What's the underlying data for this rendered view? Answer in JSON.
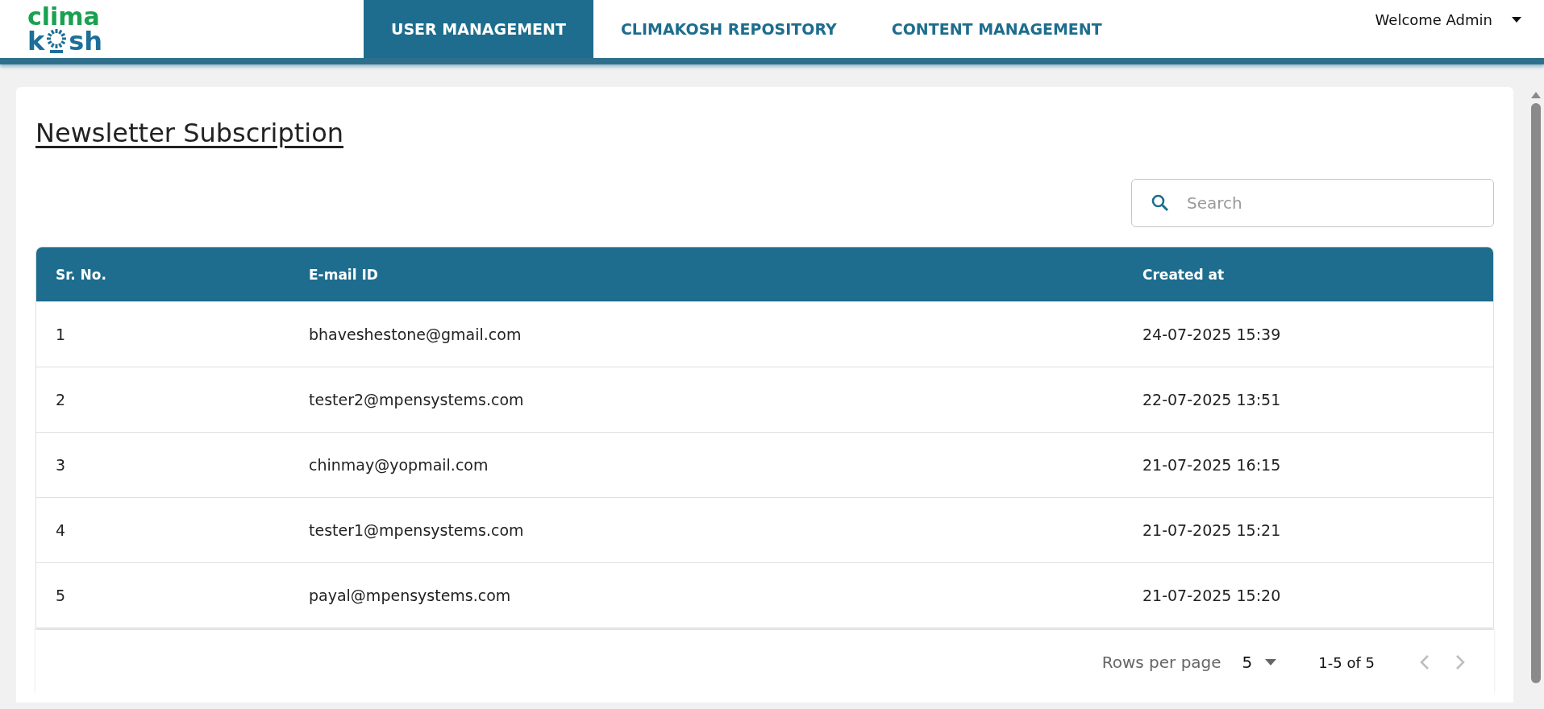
{
  "logo": {
    "top": "clima",
    "bottom_left": "k",
    "bottom_right": "sh"
  },
  "nav": [
    {
      "label": "USER MANAGEMENT",
      "selected": true
    },
    {
      "label": "CLIMAKOSH REPOSITORY",
      "selected": false
    },
    {
      "label": "CONTENT MANAGEMENT",
      "selected": false
    }
  ],
  "user_menu": {
    "label": "Welcome Admin"
  },
  "page_title": "Newsletter Subscription",
  "search": {
    "placeholder": "Search"
  },
  "table": {
    "columns": [
      "Sr. No.",
      "E-mail ID",
      "Created at"
    ],
    "rows": [
      [
        "1",
        "bhaveshestone@gmail.com",
        "24-07-2025 15:39"
      ],
      [
        "2",
        "tester2@mpensystems.com",
        "22-07-2025 13:51"
      ],
      [
        "3",
        "chinmay@yopmail.com",
        "21-07-2025 16:15"
      ],
      [
        "4",
        "tester1@mpensystems.com",
        "21-07-2025 15:21"
      ],
      [
        "5",
        "payal@mpensystems.com",
        "21-07-2025 15:20"
      ]
    ]
  },
  "pagination": {
    "rows_per_page_label": "Rows per page",
    "rows_per_page": "5",
    "range": "1-5 of 5",
    "prev_disabled": true,
    "next_disabled": true
  }
}
